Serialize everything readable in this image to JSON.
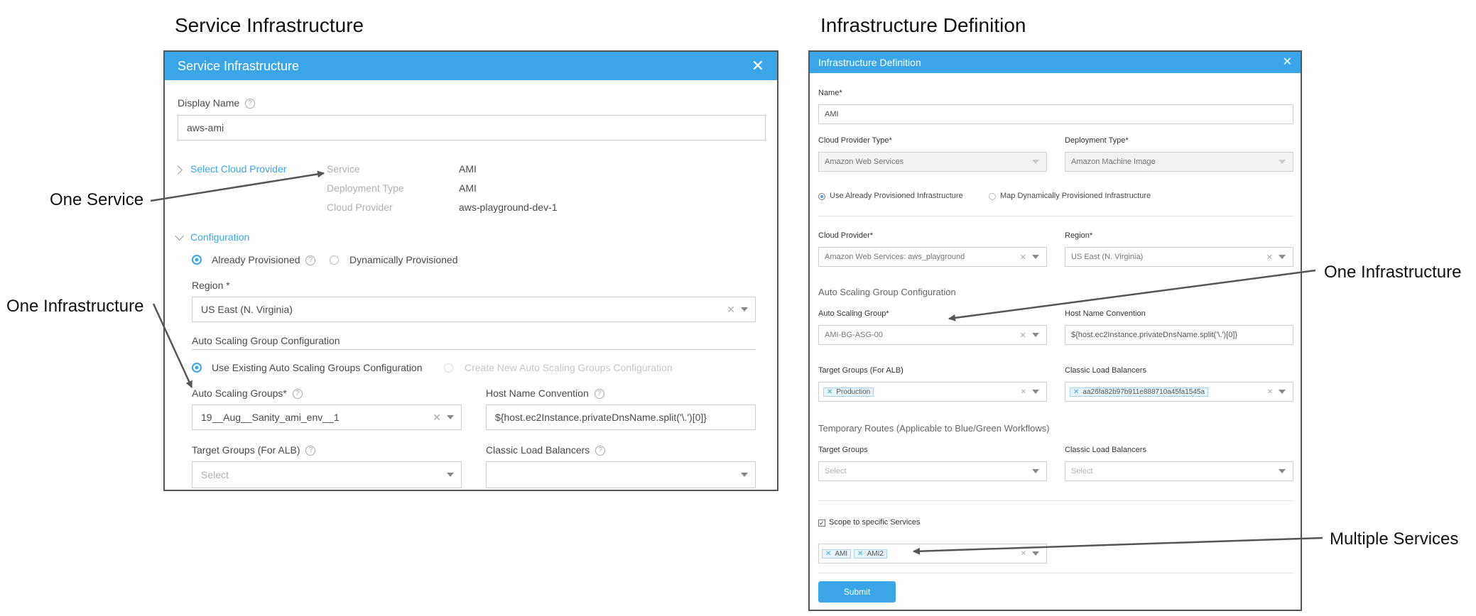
{
  "headings": {
    "left": "Service Infrastructure",
    "right": "Infrastructure Definition"
  },
  "callouts": {
    "one_service": "One Service",
    "one_infrastructure_left": "One Infrastructure",
    "one_infrastructure_right": "One Infrastructure",
    "multiple_services": "Multiple Services"
  },
  "service_infra": {
    "title": "Service Infrastructure",
    "close": "✕",
    "display_name_label": "Display Name",
    "display_name_value": "aws-ami",
    "select_cloud_provider": "Select Cloud Provider",
    "summary": [
      {
        "label": "Service",
        "value": "AMI"
      },
      {
        "label": "Deployment Type",
        "value": "AMI"
      },
      {
        "label": "Cloud Provider",
        "value": "aws-playground-dev-1"
      }
    ],
    "configuration": "Configuration",
    "already_provisioned": "Already Provisioned",
    "dynamically_provisioned": "Dynamically Provisioned",
    "region_label": "Region *",
    "region_value": "US East (N. Virginia)",
    "asg_config_label": "Auto Scaling Group Configuration",
    "use_existing": "Use Existing Auto Scaling Groups Configuration",
    "create_new": "Create New Auto Scaling Groups Configuration",
    "asg_label": "Auto Scaling Groups*",
    "asg_value": "19__Aug__Sanity_ami_env__1",
    "host_name_label": "Host Name Convention",
    "host_name_value": "${host.ec2Instance.privateDnsName.split('\\.')[0]}",
    "target_groups_label": "Target Groups (For ALB)",
    "target_groups_placeholder": "Select",
    "clb_label": "Classic Load Balancers"
  },
  "infra_def": {
    "title": "Infrastructure Definition",
    "close": "✕",
    "name_label": "Name*",
    "name_value": "AMI",
    "cloud_provider_type_label": "Cloud Provider Type*",
    "cloud_provider_type_value": "Amazon Web Services",
    "deployment_type_label": "Deployment Type*",
    "deployment_type_value": "Amazon Machine Image",
    "use_already": "Use Already Provisioned Infrastructure",
    "map_dynamic": "Map Dynamically Provisioned Infrastructure",
    "cloud_provider_label": "Cloud Provider*",
    "cloud_provider_value": "Amazon Web Services: aws_playground",
    "region_label": "Region*",
    "region_value": "US East (N. Virginia)",
    "asg_config_label": "Auto Scaling Group Configuration",
    "asg_label": "Auto Scaling Group*",
    "asg_value": "AMI-BG-ASG-00",
    "host_name_label": "Host Name Convention",
    "host_name_value": "${host.ec2Instance.privateDnsName.split('\\.')[0]}",
    "target_groups_alb_label": "Target Groups (For ALB)",
    "target_groups_alb_tag": "Production",
    "clb_label": "Classic Load Balancers",
    "clb_tag": "aa26fa82b97b911e888710a45fa1545a",
    "temp_routes_label": "Temporary Routes (Applicable to Blue/Green Workflows)",
    "temp_target_groups_label": "Target Groups",
    "temp_target_groups_placeholder": "Select",
    "temp_clb_label": "Classic Load Balancers",
    "temp_clb_placeholder": "Select",
    "scope_label": "Scope to specific Services",
    "scope_tags": [
      "AMI",
      "AMI2"
    ],
    "submit": "Submit"
  },
  "colors": {
    "accent": "#3aa6e8",
    "arrow": "#555555"
  }
}
